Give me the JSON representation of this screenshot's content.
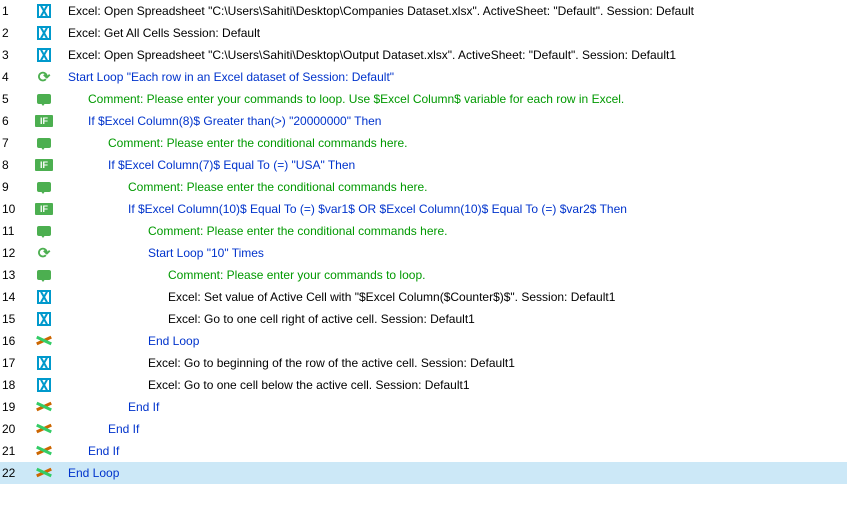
{
  "lines": [
    {
      "num": "1",
      "icon": "excel",
      "indent": 0,
      "color": "black",
      "selected": false,
      "text": "Excel: Open Spreadsheet \"C:\\Users\\Sahiti\\Desktop\\Companies Dataset.xlsx\". ActiveSheet: \"Default\". Session: Default"
    },
    {
      "num": "2",
      "icon": "excel",
      "indent": 0,
      "color": "black",
      "selected": false,
      "text": "Excel: Get All Cells Session: Default"
    },
    {
      "num": "3",
      "icon": "excel",
      "indent": 0,
      "color": "black",
      "selected": false,
      "text": "Excel: Open Spreadsheet \"C:\\Users\\Sahiti\\Desktop\\Output Dataset.xlsx\". ActiveSheet: \"Default\". Session: Default1"
    },
    {
      "num": "4",
      "icon": "loop",
      "indent": 0,
      "color": "blue",
      "selected": false,
      "text": "Start Loop \"Each row in an Excel dataset of Session: Default\""
    },
    {
      "num": "5",
      "icon": "comment",
      "indent": 1,
      "color": "green",
      "selected": false,
      "text": "Comment: Please enter your commands to loop. Use $Excel Column$ variable for each row in Excel."
    },
    {
      "num": "6",
      "icon": "if",
      "indent": 1,
      "color": "blue",
      "selected": false,
      "text": "If $Excel Column(8)$ Greater than(>) \"20000000\" Then"
    },
    {
      "num": "7",
      "icon": "comment",
      "indent": 2,
      "color": "green",
      "selected": false,
      "text": "Comment: Please enter the conditional commands here."
    },
    {
      "num": "8",
      "icon": "if",
      "indent": 2,
      "color": "blue",
      "selected": false,
      "text": "If $Excel Column(7)$ Equal To (=) \"USA\" Then"
    },
    {
      "num": "9",
      "icon": "comment",
      "indent": 3,
      "color": "green",
      "selected": false,
      "text": "Comment: Please enter the conditional commands here."
    },
    {
      "num": "10",
      "icon": "if",
      "indent": 3,
      "color": "blue",
      "selected": false,
      "text": "If $Excel Column(10)$ Equal To (=) $var1$ OR $Excel Column(10)$ Equal To (=) $var2$ Then"
    },
    {
      "num": "11",
      "icon": "comment",
      "indent": 4,
      "color": "green",
      "selected": false,
      "text": "Comment: Please enter the conditional commands here."
    },
    {
      "num": "12",
      "icon": "loop",
      "indent": 4,
      "color": "blue",
      "selected": false,
      "text": "Start Loop \"10\" Times"
    },
    {
      "num": "13",
      "icon": "comment",
      "indent": 5,
      "color": "green",
      "selected": false,
      "text": "Comment: Please enter your commands to loop."
    },
    {
      "num": "14",
      "icon": "excel",
      "indent": 5,
      "color": "black",
      "selected": false,
      "text": "Excel: Set value of Active Cell with \"$Excel Column($Counter$)$\". Session: Default1"
    },
    {
      "num": "15",
      "icon": "excel",
      "indent": 5,
      "color": "black",
      "selected": false,
      "text": "Excel: Go to one cell right of active cell. Session: Default1"
    },
    {
      "num": "16",
      "icon": "endif",
      "indent": 4,
      "color": "blue",
      "selected": false,
      "text": "End Loop"
    },
    {
      "num": "17",
      "icon": "excel",
      "indent": 4,
      "color": "black",
      "selected": false,
      "text": "Excel: Go to beginning of the row of the active cell. Session: Default1"
    },
    {
      "num": "18",
      "icon": "excel",
      "indent": 4,
      "color": "black",
      "selected": false,
      "text": "Excel: Go to one cell below the active cell. Session: Default1"
    },
    {
      "num": "19",
      "icon": "endif",
      "indent": 3,
      "color": "blue",
      "selected": false,
      "text": "End If"
    },
    {
      "num": "20",
      "icon": "endif",
      "indent": 2,
      "color": "blue",
      "selected": false,
      "text": "End If"
    },
    {
      "num": "21",
      "icon": "endif",
      "indent": 1,
      "color": "blue",
      "selected": false,
      "text": "End If"
    },
    {
      "num": "22",
      "icon": "endif",
      "indent": 0,
      "color": "blue",
      "selected": true,
      "text": "End Loop"
    }
  ],
  "iflabel": "IF"
}
